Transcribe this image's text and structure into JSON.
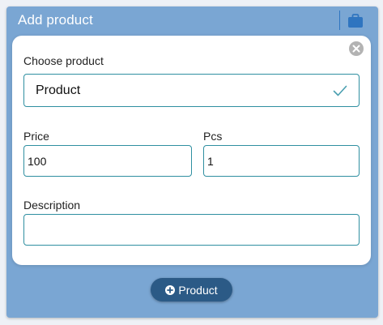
{
  "header": {
    "title": "Add product",
    "icon": "shopping-bag-icon"
  },
  "form": {
    "choose_label": "Choose product",
    "product_value": "Product",
    "price_label": "Price",
    "price_value": "100",
    "pcs_label": "Pcs",
    "pcs_value": "1",
    "description_label": "Description",
    "description_value": ""
  },
  "actions": {
    "add_label": "Product"
  },
  "colors": {
    "panel_bg": "#7aa6d3",
    "accent": "#2b5a86",
    "field_border": "#2f8fa1",
    "icon_blue": "#2f75c0"
  }
}
